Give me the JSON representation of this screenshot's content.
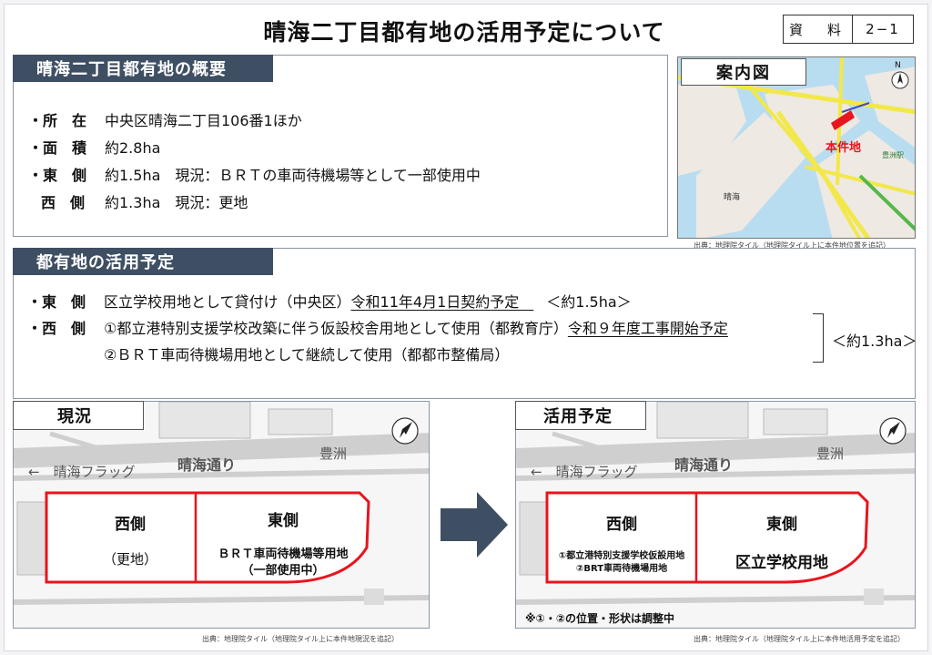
{
  "title": "晴海二丁目都有地の活用予定について",
  "doc_ref": {
    "label": "資　料",
    "number": "2−1"
  },
  "overview": {
    "header": "晴海二丁目都有地の概要",
    "rows": [
      {
        "label": "・所　在",
        "value": "中央区晴海二丁目106番1ほか"
      },
      {
        "label": "・面　積",
        "value": "約2.8ha"
      },
      {
        "label": "・東　側",
        "value": "約1.5ha　現況：ＢＲＴの車両待機場等として一部使用中"
      },
      {
        "label": "西　側",
        "value": "約1.3ha　現況：更地"
      }
    ]
  },
  "guide_map": {
    "title": "案内図",
    "site_label": "本件地",
    "place_harumi": "晴海",
    "place_toyosu_station": "豊洲駅",
    "north": "N",
    "source": "出典：地理院タイル（地理院タイル上に本件地位置を追記）"
  },
  "plan": {
    "header": "都有地の活用予定",
    "east": {
      "label": "・東　側",
      "text": "区立学校用地として貸付け（中央区）",
      "underlined": "令和11年4月1日契約予定　",
      "area": "＜約1.5ha＞"
    },
    "west": {
      "label": "・西　側",
      "item1": "①都立港特別支援学校改築に伴う仮設校舎用地として使用（都教育庁）",
      "item1_underlined": "令和９年度工事開始予定",
      "item2": "②ＢＲＴ車両待機場用地として継続して使用（都都市整備局）",
      "area": "＜約1.3ha＞"
    }
  },
  "current": {
    "title": "現況",
    "road_main": "晴海通り",
    "flag_road": "←　晴海フラッグ",
    "toyosu": "豊洲",
    "west_name": "西側",
    "west_desc": "（更地）",
    "east_name": "東側",
    "east_desc1": "ＢＲＴ車両待機場等用地",
    "east_desc2": "（一部使用中）",
    "source": "出典：地理院タイル（地理院タイル上に本件地現況を追記）"
  },
  "future": {
    "title": "活用予定",
    "road_main": "晴海通り",
    "flag_road": "←　晴海フラッグ",
    "toyosu": "豊洲",
    "west_name": "西側",
    "west_desc1": "①都立港特別支援学校仮設用地",
    "west_desc2": "②BRT車両待機場用地",
    "east_name": "東側",
    "east_desc": "区立学校用地",
    "note": "※①・②の位置・形状は調整中",
    "source": "出典：地理院タイル（地理院タイル上に本件地活用予定を追記）"
  },
  "colors": {
    "header_bg": "#3f4f63",
    "site_outline": "#e8141e",
    "arrow": "#3f4f63",
    "road": "#f2e84a"
  }
}
